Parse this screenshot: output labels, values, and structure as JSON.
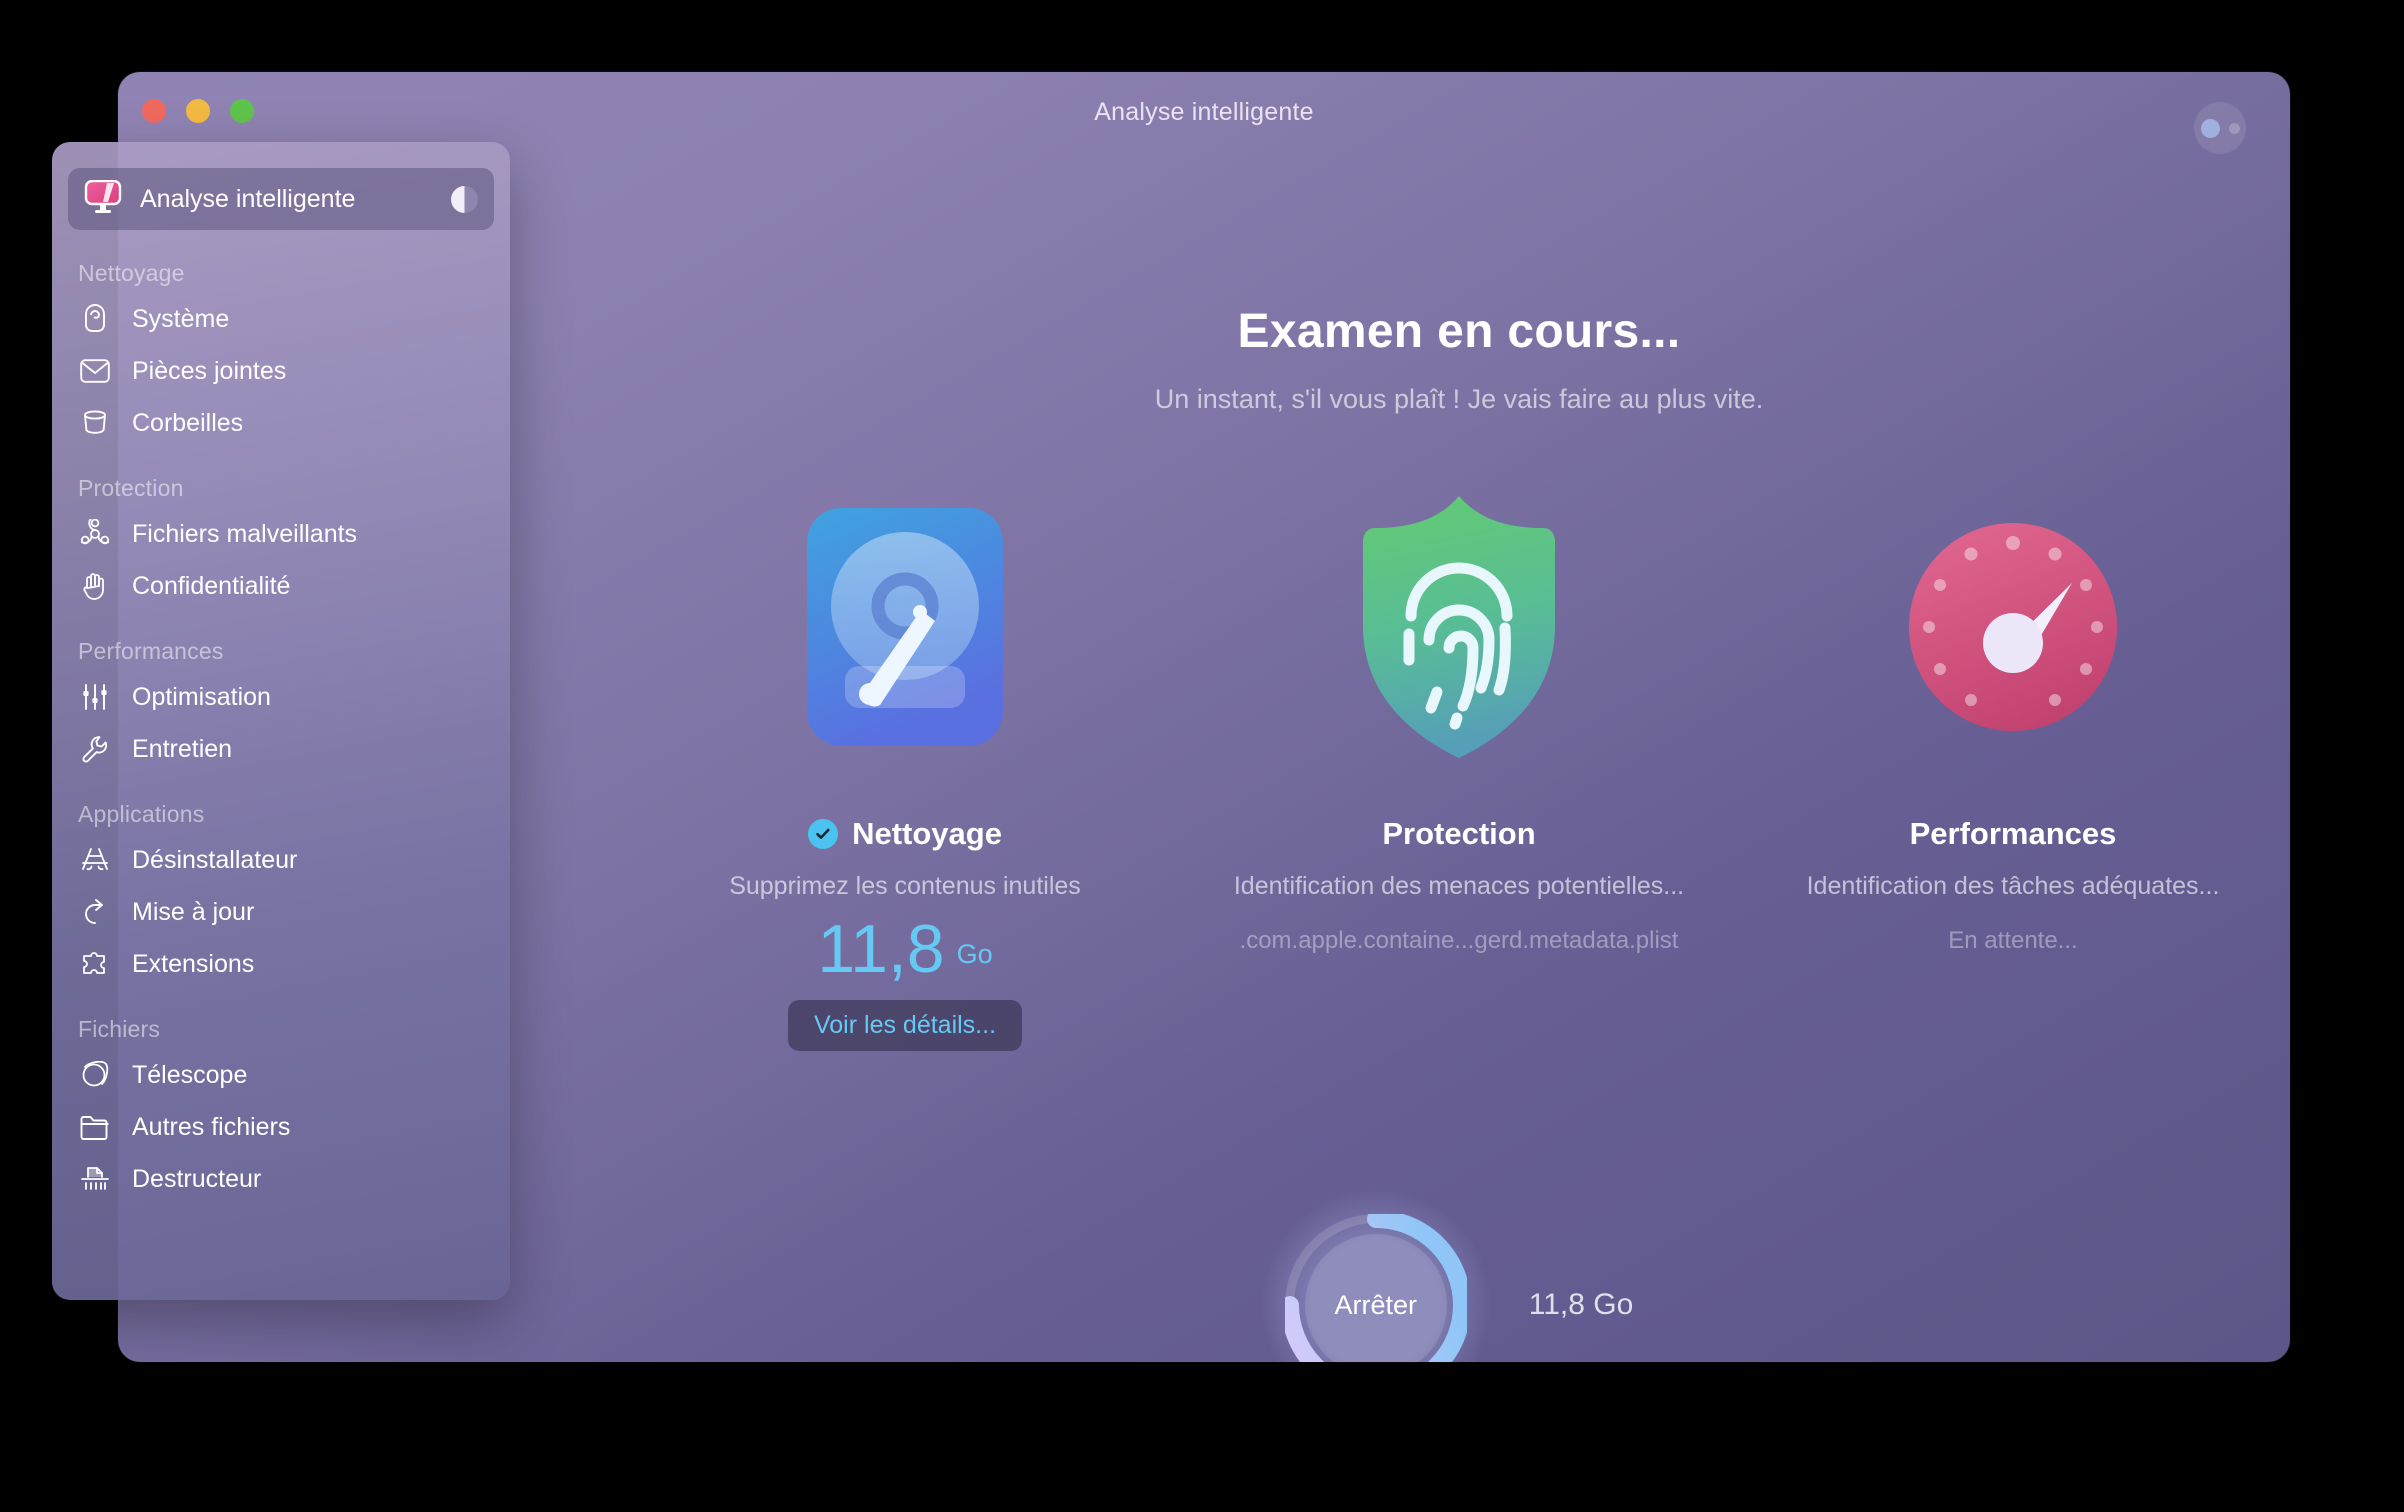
{
  "window": {
    "title": "Analyse intelligente",
    "traffic_lights": [
      "close",
      "minimize",
      "zoom"
    ],
    "top_right_button": "view-toggle"
  },
  "sidebar": {
    "active_item": {
      "label": "Analyse intelligente",
      "icon": "smart-scan-monitor-icon",
      "progress_badge": "half-pie"
    },
    "groups": [
      {
        "title": "Nettoyage",
        "items": [
          {
            "label": "Système",
            "icon": "system-junk-icon"
          },
          {
            "label": "Pièces jointes",
            "icon": "mail-attachments-icon"
          },
          {
            "label": "Corbeilles",
            "icon": "trash-bins-icon"
          }
        ]
      },
      {
        "title": "Protection",
        "items": [
          {
            "label": "Fichiers malveillants",
            "icon": "biohazard-malware-icon"
          },
          {
            "label": "Confidentialité",
            "icon": "hand-privacy-icon"
          }
        ]
      },
      {
        "title": "Performances",
        "items": [
          {
            "label": "Optimisation",
            "icon": "sliders-optimization-icon"
          },
          {
            "label": "Entretien",
            "icon": "wrench-maintenance-icon"
          }
        ]
      },
      {
        "title": "Applications",
        "items": [
          {
            "label": "Désinstallateur",
            "icon": "appstore-uninstaller-icon"
          },
          {
            "label": "Mise à jour",
            "icon": "updater-arrow-icon"
          },
          {
            "label": "Extensions",
            "icon": "puzzle-extensions-icon"
          }
        ]
      },
      {
        "title": "Fichiers",
        "items": [
          {
            "label": "Télescope",
            "icon": "planet-space-lens-icon"
          },
          {
            "label": "Autres fichiers",
            "icon": "folder-icon"
          },
          {
            "label": "Destructeur",
            "icon": "shredder-icon"
          }
        ]
      }
    ]
  },
  "main": {
    "headline": "Examen en cours...",
    "subhead": "Un instant, s'il vous plaît ! Je vais faire au plus vite.",
    "cards": [
      {
        "icon": "hard-drive-icon",
        "title": "Nettoyage",
        "status_icon": "check-circle-icon",
        "subtitle": "Supprimez les contenus inutiles",
        "size_value": "11,8",
        "size_unit": "Go",
        "action_label": "Voir les détails..."
      },
      {
        "icon": "shield-fingerprint-icon",
        "title": "Protection",
        "subtitle": "Identification des menaces potentielles...",
        "detail": ".com.apple.containe...gerd.metadata.plist"
      },
      {
        "icon": "speedometer-icon",
        "title": "Performances",
        "subtitle": "Identification des tâches adéquates...",
        "detail": "En attente..."
      }
    ],
    "stop_button": {
      "label": "Arrêter",
      "progress_percent": 75
    },
    "total_found": "11,8 Go"
  },
  "colors": {
    "accent_blue": "#65c9f4",
    "window_top": "#9184b4",
    "window_bottom": "#5c5689",
    "shield_green": "#5bc97f",
    "gauge_pink": "#d4507f"
  }
}
